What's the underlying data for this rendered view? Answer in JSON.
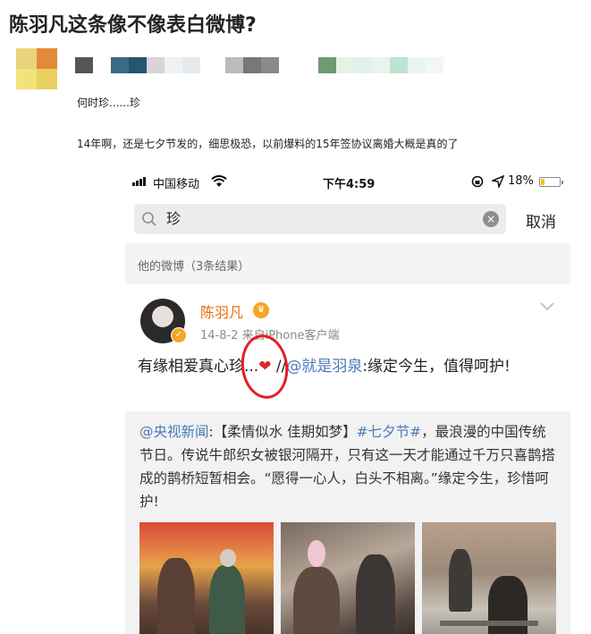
{
  "page": {
    "title": "陈羽凡这条像不像表白微博?"
  },
  "post": {
    "line1": "何时珍......珍",
    "line2": "14年啊，还是七夕节发的，细思极恐，以前爆料的15年签协议离婚大概是真的了"
  },
  "phone": {
    "status": {
      "carrier": "中国移动",
      "time": "下午4:59",
      "battery": "18%",
      "battery_level": 0.18
    },
    "search": {
      "query": "珍",
      "cancel": "取消"
    },
    "results_header": "他的微博（3条结果）",
    "card": {
      "username": "陈羽凡",
      "date": "14-8-2",
      "source": "来自iPhone客户端",
      "text_main": "有缘相爱真心珍...",
      "heart": "❤",
      "text_sep": " //",
      "mention": "@就是羽泉",
      "text_rest": ":缘定今生，值得呵护!",
      "repost": {
        "source": "@央视新闻",
        "hashtag": "#七夕节#",
        "part1": ":【柔情似水 佳期如梦】",
        "part2": "，最浪漫的中国传统节日。传说牛郎织女被银河隔开，只有这一天才能通过千万只喜鹊搭成的鹊桥短暂相会。“愿得一心人，白头不相离。”缘定今生，珍惜呵护!"
      }
    }
  },
  "colors": {
    "username": "#e86b0e",
    "link": "#4a7ab8",
    "annotation_circle": "#e41c23",
    "heart": "#e0262a",
    "battery": "#f6c117"
  }
}
